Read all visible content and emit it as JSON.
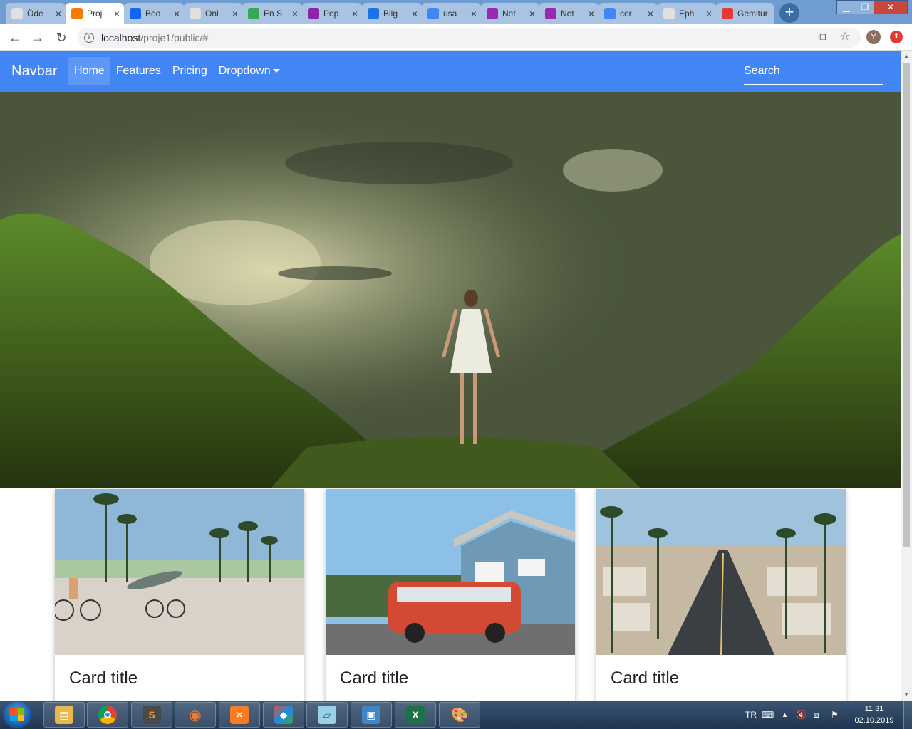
{
  "browser": {
    "tabs": [
      {
        "label": "Öde",
        "favicon": "document-icon",
        "color": "#e0e0e0",
        "active": false
      },
      {
        "label": "Proj",
        "favicon": "xampp-icon",
        "color": "#f57c00",
        "active": true
      },
      {
        "label": "Boo",
        "favicon": "mdb-icon",
        "color": "#1266f1",
        "active": false
      },
      {
        "label": "Onl",
        "favicon": "document-icon",
        "color": "#e0e0e0",
        "active": false
      },
      {
        "label": "En S",
        "favicon": "drive-icon",
        "color": "#34a853",
        "active": false
      },
      {
        "label": "Pop",
        "favicon": "book-icon",
        "color": "#8e24aa",
        "active": false
      },
      {
        "label": "Bilg",
        "favicon": "circle-o-icon",
        "color": "#1a73e8",
        "active": false
      },
      {
        "label": "usa",
        "favicon": "google-icon",
        "color": "#4285f4",
        "active": false
      },
      {
        "label": "Net",
        "favicon": "umbrella-icon",
        "color": "#9c27b0",
        "active": false
      },
      {
        "label": "Net",
        "favicon": "umbrella-icon",
        "color": "#9c27b0",
        "active": false
      },
      {
        "label": "cor",
        "favicon": "google-icon",
        "color": "#4285f4",
        "active": false
      },
      {
        "label": "Eph",
        "favicon": "document-icon",
        "color": "#e0e0e0",
        "active": false
      },
      {
        "label": "Gemitur",
        "favicon": "chart-icon",
        "color": "#e53935",
        "active": false
      }
    ],
    "new_tab": "+",
    "url_host": "localhost",
    "url_path": "/proje1/public/#",
    "profile_initial": "Y"
  },
  "page": {
    "navbar": {
      "brand": "Navbar",
      "links": [
        "Home",
        "Features",
        "Pricing",
        "Dropdown"
      ],
      "active": "Home",
      "search_placeholder": "Search",
      "accent": "#4285f4"
    },
    "cards": [
      {
        "title": "Card title",
        "image": "beach-cyclists-photo"
      },
      {
        "title": "Card title",
        "image": "red-van-house-photo"
      },
      {
        "title": "Card title",
        "image": "palm-street-aerial-photo"
      }
    ]
  },
  "taskbar": {
    "apps": [
      "explorer",
      "chrome",
      "sublime-text",
      "blender",
      "xampp",
      "git",
      "notepad",
      "photos",
      "excel",
      "paint"
    ],
    "language": "TR",
    "time": "11:31",
    "date": "02.10.2019"
  }
}
